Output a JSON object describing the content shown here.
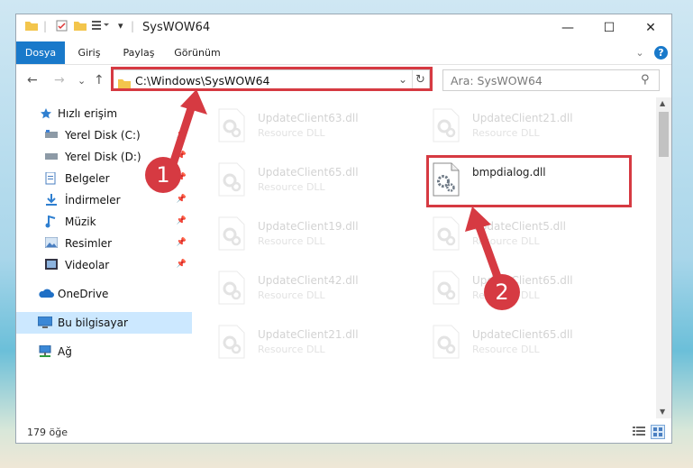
{
  "window": {
    "title": "SysWOW64",
    "minimize_glyph": "—",
    "maximize_glyph": "☐",
    "close_glyph": "✕"
  },
  "ribbon": {
    "tabs": [
      "Dosya",
      "Giriş",
      "Paylaş",
      "Görünüm"
    ],
    "help_glyph": "?",
    "expand_glyph": "⌄"
  },
  "navigation": {
    "back_glyph": "←",
    "forward_glyph": "→",
    "recent_glyph": "⌄",
    "up_glyph": "↑",
    "address": "C:\\Windows\\SysWOW64",
    "dropdown_glyph": "⌄",
    "refresh_glyph": "↻",
    "search_placeholder": "Ara: SysWOW64",
    "search_glyph": "⚲"
  },
  "sidebar": {
    "items": [
      {
        "label": "Hızlı erişim",
        "icon": "star-icon",
        "pinned": false
      },
      {
        "label": "Yerel Disk (C:)",
        "icon": "drive-icon",
        "pinned": true
      },
      {
        "label": "Yerel Disk (D:)",
        "icon": "drive-icon",
        "pinned": true
      },
      {
        "label": "Belgeler",
        "icon": "documents-icon",
        "pinned": true
      },
      {
        "label": "İndirmeler",
        "icon": "download-icon",
        "pinned": true
      },
      {
        "label": "Müzik",
        "icon": "music-icon",
        "pinned": true
      },
      {
        "label": "Resimler",
        "icon": "pictures-icon",
        "pinned": true
      },
      {
        "label": "Videolar",
        "icon": "videos-icon",
        "pinned": true
      },
      {
        "label": "OneDrive",
        "icon": "cloud-icon",
        "pinned": false
      },
      {
        "label": "Bu bilgisayar",
        "icon": "computer-icon",
        "pinned": false
      },
      {
        "label": "Ağ",
        "icon": "network-icon",
        "pinned": false
      }
    ]
  },
  "files": [
    {
      "name": "UpdateClient63.dll",
      "type": "Resource DLL",
      "faded": true
    },
    {
      "name": "UpdateClient21.dll",
      "type": "Resource DLL",
      "faded": true
    },
    {
      "name": "UpdateClient65.dll",
      "type": "Resource DLL",
      "faded": true
    },
    {
      "name": "bmpdialog.dll",
      "type": "",
      "faded": false
    },
    {
      "name": "UpdateClient19.dll",
      "type": "Resource DLL",
      "faded": true
    },
    {
      "name": "UpdateClient5.dll",
      "type": "Resource DLL",
      "faded": true
    },
    {
      "name": "UpdateClient42.dll",
      "type": "Resource DLL",
      "faded": true
    },
    {
      "name": "UpdateClient65.dll",
      "type": "Resource DLL",
      "faded": true
    },
    {
      "name": "UpdateClient21.dll",
      "type": "Resource DLL",
      "faded": true
    },
    {
      "name": "UpdateClient65.dll",
      "type": "Resource DLL",
      "faded": true
    }
  ],
  "status": {
    "item_count": "179 öğe"
  },
  "annotations": {
    "step1": "1",
    "step2": "2",
    "color": "#d63a42"
  }
}
